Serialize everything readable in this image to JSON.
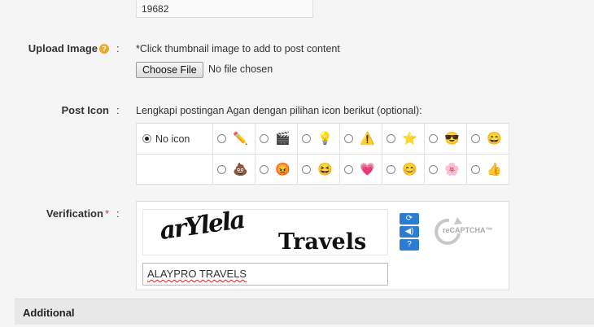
{
  "zip_value": "19682",
  "upload": {
    "label": "Upload Image",
    "help_icon": "help-icon",
    "note": "*Click thumbnail image to add to post content",
    "button_label": "Choose File",
    "status": "No file chosen"
  },
  "post_icon": {
    "label": "Post Icon",
    "note": "Lengkapi postingan Agan dengan pilihan icon berikut (optional):",
    "no_icon_label": "No icon",
    "icons_row1": [
      "pencil-icon",
      "clapperboard-icon",
      "lightbulb-icon",
      "warning-icon",
      "star-icon",
      "cool-smiley-icon",
      "grin-smiley-icon"
    ],
    "icons_row2": [
      "poop-icon",
      "angry-smiley-icon",
      "laugh-smiley-icon",
      "heart-icon",
      "blue-smiley-icon",
      "flower-icon",
      "thumbs-up-icon"
    ],
    "glyphs_row1": [
      "✏️",
      "🎬",
      "💡",
      "⚠️",
      "⭐",
      "😎",
      "😄"
    ],
    "glyphs_row2": [
      "💩",
      "😡",
      "😆",
      "💗",
      "😊",
      "🌸",
      "👍"
    ]
  },
  "verification": {
    "label": "Verification",
    "required_mark": "*",
    "captcha_word1": "arYlela",
    "captcha_word2": "Travels",
    "input_value": "ALAYPRO TRAVELS",
    "recaptcha_mark": "reCAPTCHA™",
    "refresh_icon": "refresh-icon",
    "audio_icon": "audio-icon",
    "help_icon": "question-icon"
  },
  "additional": {
    "label": "Additional"
  },
  "colon": ":",
  "colors": {
    "accent_blue": "#2b7cd3",
    "help_orange": "#f0a830",
    "required_red": "#d33"
  }
}
